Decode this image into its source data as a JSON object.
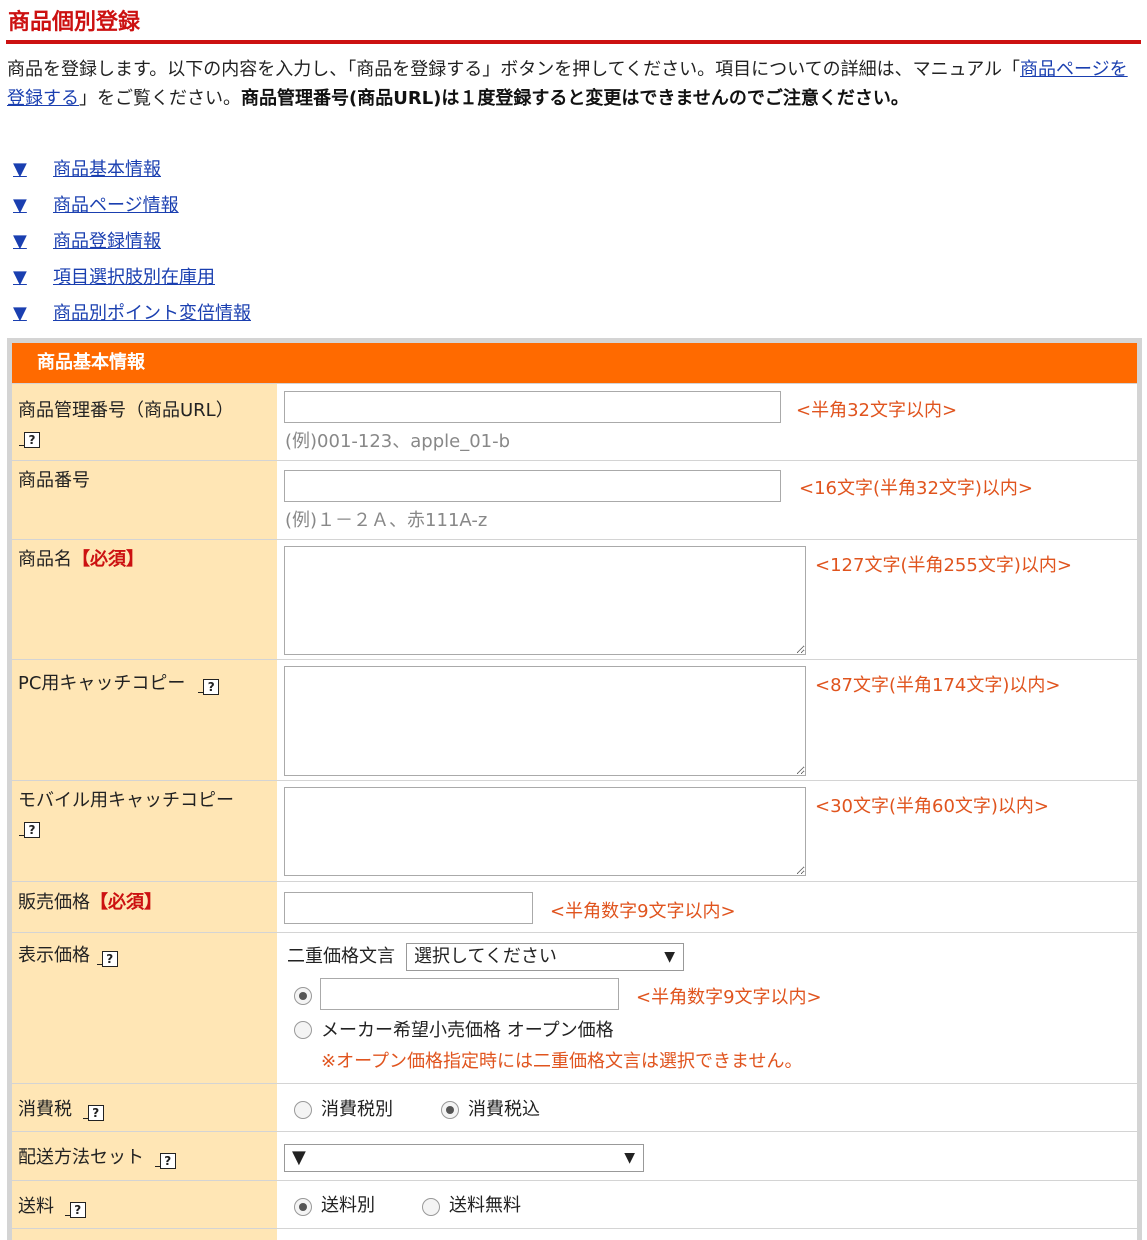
{
  "page": {
    "title": "商品個別登録",
    "intro_1": "商品を登録します。以下の内容を入力し、「商品を登録する」ボタンを押してください。項目についての詳細は、マニュアル「",
    "intro_link": "商品ページを登録する",
    "intro_2": "」をご覧ください。",
    "intro_bold": "商品管理番号(商品URL)は１度登録すると変更はできませんのでご注意ください。"
  },
  "toc": [
    {
      "marker": "▼",
      "label": "商品基本情報"
    },
    {
      "marker": "▼",
      "label": "商品ページ情報"
    },
    {
      "marker": "▼",
      "label": "商品登録情報"
    },
    {
      "marker": "▼",
      "label": "項目選択肢別在庫用"
    },
    {
      "marker": "▼",
      "label": "商品別ポイント変倍情報"
    }
  ],
  "section": {
    "title": "商品基本情報"
  },
  "help_glyph": "?",
  "required_mark": "【必須】",
  "fields": {
    "manage_no": {
      "label": "商品管理番号（商品URL）",
      "limit": "<半角32文字以内>",
      "example": "(例)001-123、apple_01-b",
      "value": ""
    },
    "item_no": {
      "label": "商品番号",
      "limit": "<16文字(半角32文字)以内>",
      "example": "(例)１－２Ａ、赤111A-z",
      "value": ""
    },
    "item_name": {
      "label": "商品名",
      "limit": "<127文字(半角255文字)以内>",
      "value": ""
    },
    "pc_catch": {
      "label": "PC用キャッチコピー",
      "limit": "<87文字(半角174文字)以内>",
      "value": ""
    },
    "mobile_catch": {
      "label": "モバイル用キャッチコピー",
      "limit": "<30文字(半角60文字)以内>",
      "value": ""
    },
    "price": {
      "label": "販売価格",
      "limit": "<半角数字9文字以内>",
      "value": ""
    },
    "display_price": {
      "label": "表示価格",
      "double_price_label": "二重価格文言",
      "select_value": "選択してください",
      "limit": "<半角数字9文字以内>",
      "value": "",
      "option_open": "メーカー希望小売価格 オープン価格",
      "note": "※オープン価格指定時には二重価格文言は選択できません。"
    },
    "tax": {
      "label": "消費税",
      "option_excl": "消費税別",
      "option_incl": "消費税込"
    },
    "delivery_set": {
      "label": "配送方法セット",
      "select_value": "▼"
    },
    "shipping": {
      "label": "送料",
      "option_separate": "送料別",
      "option_free": "送料無料"
    }
  },
  "icons": {
    "select_arrow": "▼"
  }
}
